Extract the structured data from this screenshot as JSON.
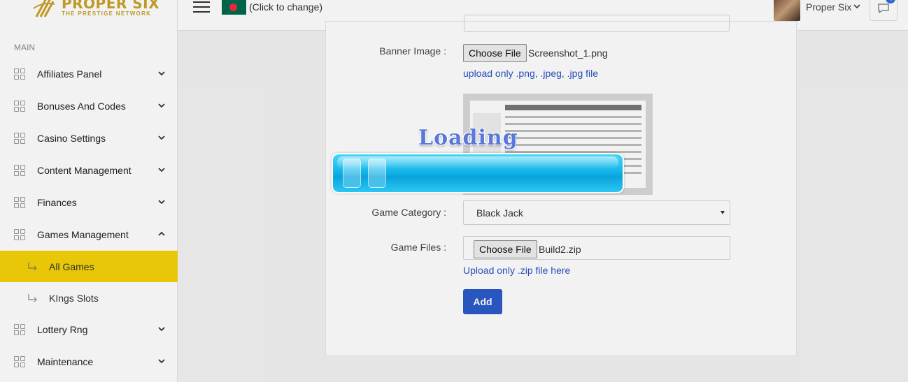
{
  "brand": {
    "title": "PROPER SIX",
    "subtitle": "THE PRESTIGE NETWORK",
    "color": "#c9a227"
  },
  "sidebar": {
    "section_label": "MAIN",
    "items": [
      {
        "label": "Affiliates Panel",
        "icon": "grid-icon",
        "chevron": "chevron-down"
      },
      {
        "label": "Bonuses And Codes",
        "icon": "grid-icon",
        "chevron": "chevron-down"
      },
      {
        "label": "Casino Settings",
        "icon": "grid-icon",
        "chevron": "chevron-down"
      },
      {
        "label": "Content Management",
        "icon": "grid-icon",
        "chevron": "chevron-down"
      },
      {
        "label": "Finances",
        "icon": "grid-icon",
        "chevron": "chevron-down"
      },
      {
        "label": "Games Management",
        "icon": "grid-icon",
        "chevron": "chevron-up",
        "expanded": true
      }
    ],
    "sub_items": [
      {
        "label": "All Games",
        "active": true,
        "icon": "sub-arrow-icon"
      },
      {
        "label": "KIngs Slots",
        "active": false,
        "icon": "sub-arrow-icon"
      }
    ],
    "items_after": [
      {
        "label": "Lottery Rng",
        "icon": "grid-icon",
        "chevron": "chevron-down"
      },
      {
        "label": "Maintenance",
        "icon": "grid-icon",
        "chevron": "chevron-down"
      }
    ],
    "active_color": "#f5d20a"
  },
  "header": {
    "language_hint": "(Click to change)",
    "flag": "bangladesh-flag-icon",
    "user_name": "Proper Six",
    "message_count": "4"
  },
  "form": {
    "banner_label": "Banner Image :",
    "banner_button": "Choose File",
    "banner_file": "Screenshot_1.png",
    "banner_hint": "upload only .png, .jpeg, .jpg file",
    "category_label": "Game Category :",
    "category_value": "Black Jack",
    "files_label": "Game Files :",
    "files_button": "Choose File",
    "files_file": "Build2.zip",
    "files_hint": "Upload only .zip file here",
    "add_button": "Add",
    "accent": "#2b5bc9"
  },
  "loading": {
    "title": "Loading",
    "bar_color": "#14b5ea"
  }
}
